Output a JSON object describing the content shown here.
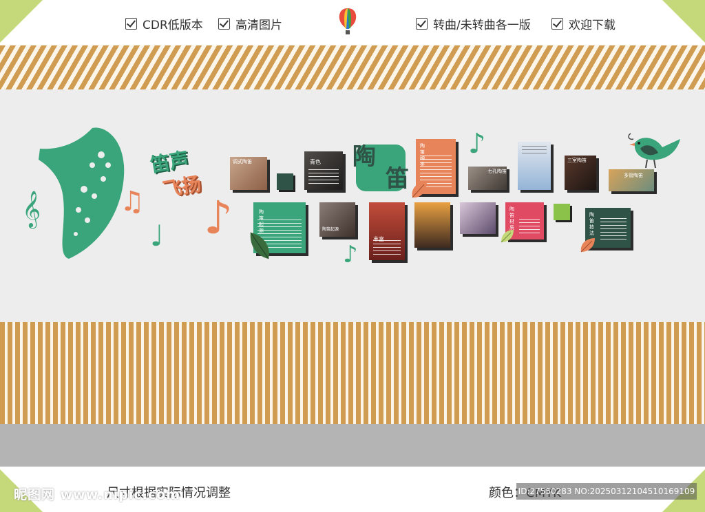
{
  "top_checks": [
    {
      "label": "CDR低版本"
    },
    {
      "label": "高清图片"
    },
    {
      "label": "转曲/未转曲各一版"
    },
    {
      "label": "欢迎下载"
    }
  ],
  "wall": {
    "slogan_line1": "笛声",
    "slogan_line2": "飞扬",
    "title_char1": "陶",
    "title_char2": "笛",
    "panels": {
      "p1_caption": "陶笛起源",
      "p2_caption": "青色",
      "p3_caption": "陶笛起源",
      "p4_caption": "丰富",
      "p5_caption": "陶笛种类",
      "p6_caption": "七孔陶笛",
      "p7_caption": "陶笛材质",
      "p8_caption": "三室陶笛",
      "p9_caption": "陶笛技法",
      "p10_caption": "调式陶笛",
      "p11_caption": "多管陶笛"
    }
  },
  "footer": {
    "size_note": "尺寸根据实际情况调整",
    "color_label": "颜色：CMYK"
  },
  "watermark": {
    "site": "昵图网 www.nipic.com",
    "id_text": "ID:27550283 NO:20250312104510169109"
  },
  "colors": {
    "green": "#3aa57b",
    "orange": "#e8845a",
    "dark_green": "#2f5347",
    "wood": "#cf9c52",
    "corner": "#c5d87a"
  }
}
